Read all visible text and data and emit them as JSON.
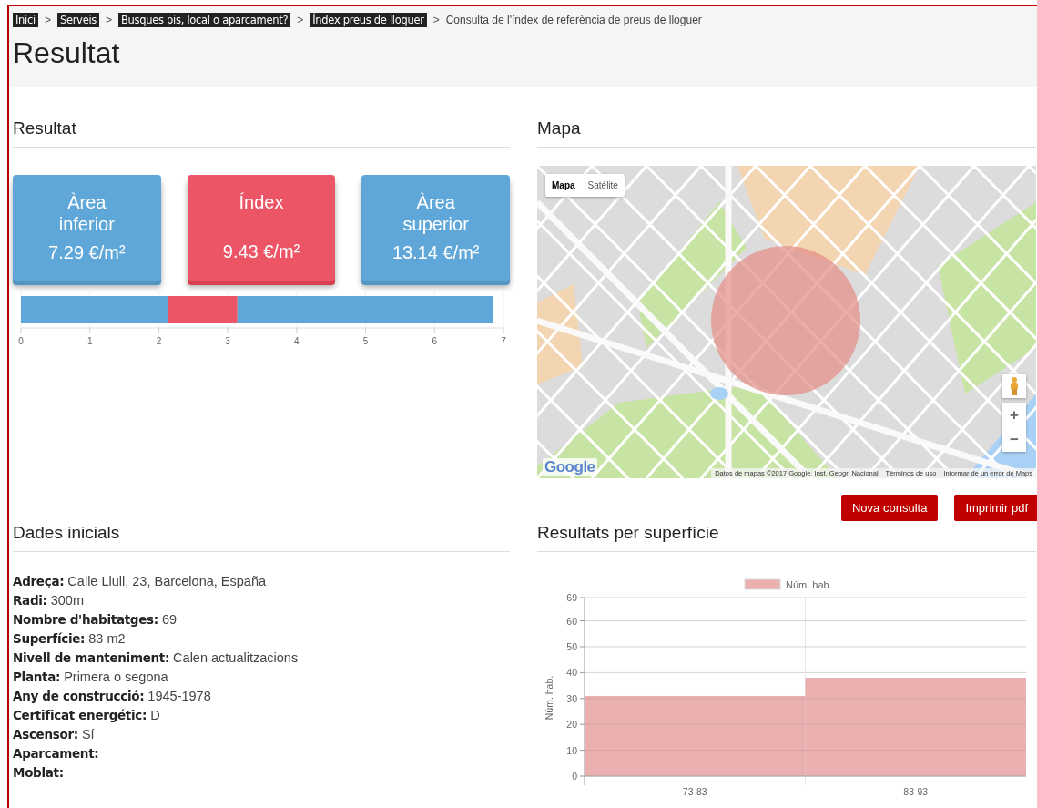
{
  "breadcrumbs": [
    {
      "label": "Inici",
      "kind": "link"
    },
    {
      "separator": ">",
      "label": "Serveis",
      "kind": "link"
    },
    {
      "separator": ">",
      "label": "Busques pis, local o aparcament?",
      "kind": "link"
    },
    {
      "separator": ">",
      "label": "Índex preus de lloguer",
      "kind": "link"
    },
    {
      "separator": ">",
      "label": "Consulta de l'índex de referència de preus de lloguer",
      "kind": "current"
    }
  ],
  "page_title": "Resultat",
  "result": {
    "heading": "Resultat",
    "cards": [
      {
        "kind": "range",
        "title": "Àrea inferior",
        "value": "7.29 €/m²"
      },
      {
        "kind": "index",
        "title": "Índex",
        "value": "9.43 €/m²"
      },
      {
        "kind": "range",
        "title": "Àrea superior",
        "value": "13.14 €/m²"
      }
    ],
    "chart_data": {
      "type": "bar",
      "orientation": "horizontal",
      "stacked": true,
      "grid": true,
      "xlim": [
        0,
        7
      ],
      "xticks": [
        0,
        1,
        2,
        3,
        4,
        5,
        6,
        7
      ],
      "series": [
        {
          "color": "#5ea7d8",
          "values": [
            2.14
          ]
        },
        {
          "color": "#ec5566",
          "values": [
            1.0
          ]
        },
        {
          "color": "#5ea7d8",
          "values": [
            3.71
          ]
        }
      ]
    }
  },
  "map": {
    "heading": "Mapa",
    "map_types": [
      {
        "label": "Mapa",
        "selected": true
      },
      {
        "label": "Satélite",
        "selected": false
      }
    ],
    "zoom_in": "+",
    "zoom_out": "−",
    "logo": "Google",
    "attribution": [
      "Datos de mapas ©2017 Google, Inst. Geogr. Nacional",
      "Términos de uso",
      "Informar de un error de Maps"
    ]
  },
  "actions": [
    "Nova consulta",
    "Imprimir pdf"
  ],
  "initial_data": {
    "heading": "Dades inicials",
    "lines": [
      "**Adreça:** Calle Llull, 23, Barcelona, España",
      "**Radi:** 300m",
      "**Nombre d'habitatges:** 69",
      "**Superfície:** 83 m2",
      "**Nivell de manteniment:** Calen actualitzacions",
      "**Planta:** Primera o segona",
      "**Any de construcció:** 1945-1978",
      "**Certificat energétic:** D",
      "**Ascensor:** Sí",
      "**Aparcament:**",
      "**Moblat:**"
    ]
  },
  "surface_results": {
    "heading": "Resultats per superfície",
    "chart_data": {
      "type": "bar",
      "grid": true,
      "ylabel": "Núm. hab.",
      "categories": [
        "73-83",
        "83-93"
      ],
      "ylim": [
        0,
        69
      ],
      "yticks": [
        0,
        10,
        20,
        30,
        40,
        50,
        60,
        69
      ],
      "series": [
        {
          "name": "Núm. hab.",
          "color": "#eab0b0",
          "values": [
            31,
            38
          ]
        }
      ]
    }
  }
}
